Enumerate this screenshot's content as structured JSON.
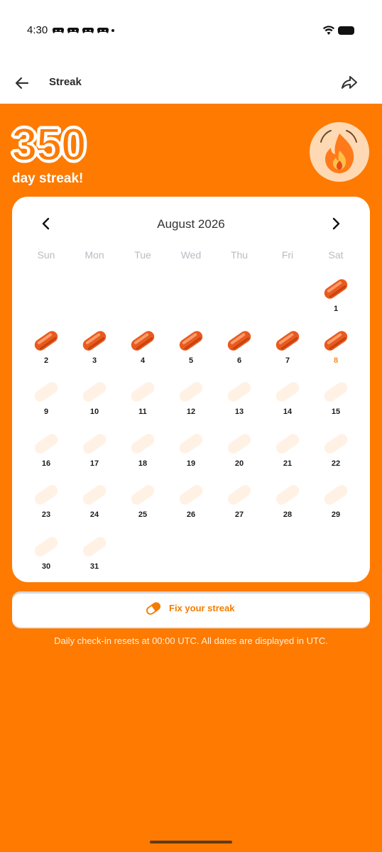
{
  "status_bar": {
    "time": "4:30"
  },
  "header": {
    "title": "Streak"
  },
  "streak": {
    "count": "350",
    "label": "day streak!"
  },
  "calendar": {
    "month_label": "August 2026",
    "weekdays": [
      "Sun",
      "Mon",
      "Tue",
      "Wed",
      "Thu",
      "Fri",
      "Sat"
    ],
    "days": [
      {
        "num": "1",
        "checked": true
      },
      {
        "num": "2",
        "checked": true
      },
      {
        "num": "3",
        "checked": true
      },
      {
        "num": "4",
        "checked": true
      },
      {
        "num": "5",
        "checked": true
      },
      {
        "num": "6",
        "checked": true
      },
      {
        "num": "7",
        "checked": true
      },
      {
        "num": "8",
        "checked": true,
        "today": true
      },
      {
        "num": "9",
        "checked": false
      },
      {
        "num": "10",
        "checked": false
      },
      {
        "num": "11",
        "checked": false
      },
      {
        "num": "12",
        "checked": false
      },
      {
        "num": "13",
        "checked": false
      },
      {
        "num": "14",
        "checked": false
      },
      {
        "num": "15",
        "checked": false
      },
      {
        "num": "16",
        "checked": false
      },
      {
        "num": "17",
        "checked": false
      },
      {
        "num": "18",
        "checked": false
      },
      {
        "num": "19",
        "checked": false
      },
      {
        "num": "20",
        "checked": false
      },
      {
        "num": "21",
        "checked": false
      },
      {
        "num": "22",
        "checked": false
      },
      {
        "num": "23",
        "checked": false
      },
      {
        "num": "24",
        "checked": false
      },
      {
        "num": "25",
        "checked": false
      },
      {
        "num": "26",
        "checked": false
      },
      {
        "num": "27",
        "checked": false
      },
      {
        "num": "28",
        "checked": false
      },
      {
        "num": "29",
        "checked": false
      },
      {
        "num": "30",
        "checked": false
      },
      {
        "num": "31",
        "checked": false
      }
    ]
  },
  "fix_button": {
    "label": "Fix your streak"
  },
  "footnote": "Daily check-in resets at 00:00 UTC. All dates are displayed in UTC.",
  "colors": {
    "accent": "#FE7A00",
    "pill_active": "#E85A1E",
    "pill_inactive": "#FFF1E4",
    "today": "#F58A24"
  },
  "icons": {
    "back": "arrow-left-icon",
    "share": "share-arrow-icon",
    "fire": "fire-badge-icon",
    "prev": "chevron-left-icon",
    "next": "chevron-right-icon",
    "pill": "pill-icon"
  }
}
